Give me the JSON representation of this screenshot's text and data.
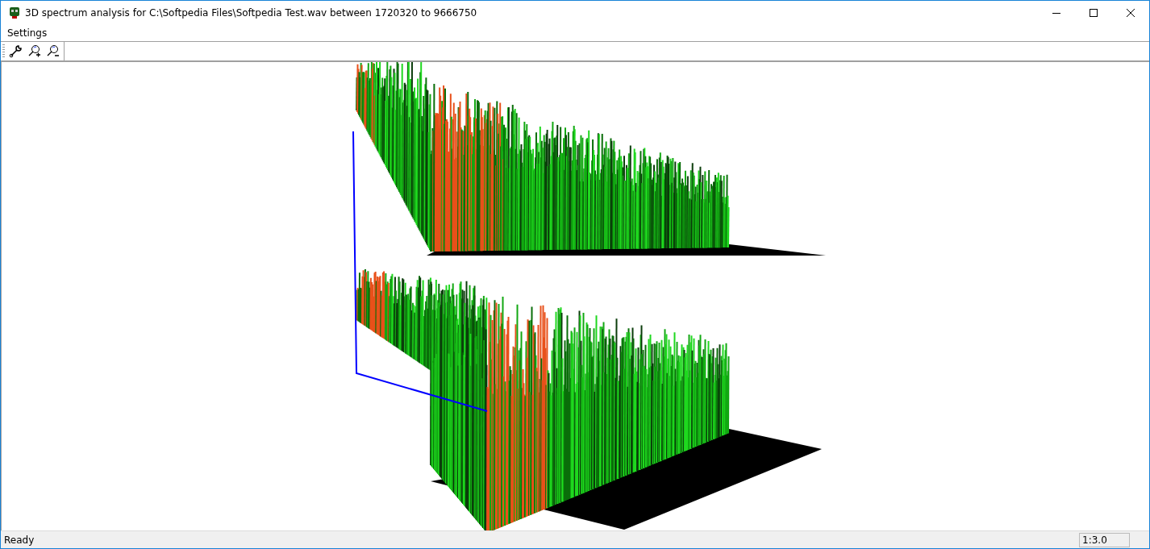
{
  "window": {
    "title": "3D spectrum analysis for C:\\Softpedia Files\\Softpedia Test.wav between 1720320 to 9666750"
  },
  "menu": [
    "Settings"
  ],
  "toolbar": [
    {
      "kind": "wrench"
    },
    {
      "kind": "zoom-in"
    },
    {
      "kind": "zoom-out"
    }
  ],
  "status_bar": {
    "text": "Ready",
    "zoom": "1:3.0"
  }
}
